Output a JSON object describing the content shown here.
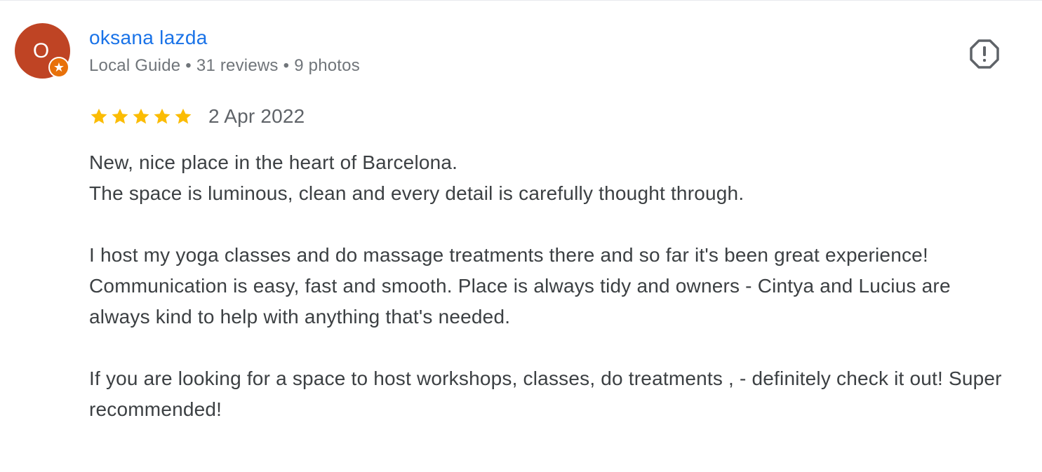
{
  "review": {
    "author": {
      "initial": "O",
      "name": "oksana lazda",
      "badge_icon": "local-guide-star-icon",
      "meta": {
        "role": "Local Guide",
        "reviews": "31 reviews",
        "photos": "9 photos",
        "separator": "•"
      }
    },
    "rating": {
      "stars": 5,
      "max": 5,
      "star_color": "#fbbc04"
    },
    "date": "2 Apr 2022",
    "body": {
      "p1_line1": "New, nice place in the heart of Barcelona.",
      "p1_line2": "The space is luminous, clean and every detail is carefully thought through.",
      "p2": "I host my yoga classes and do massage treatments there and so far it's been great experience!",
      "p3": "Communication is easy, fast and smooth. Place is always tidy and owners - Cintya and Lucius are always kind to help with anything that's needed.",
      "p4": "If you are looking for a space to host workshops, classes, do treatments , - definitely check it out! Super recommended!"
    },
    "report_icon": "report-flag-icon"
  },
  "colors": {
    "author_name": "#1a73e8",
    "avatar_bg": "#bf4424",
    "badge_bg": "#e8710a",
    "meta_text": "#70757a",
    "body_text": "#3c4043"
  }
}
